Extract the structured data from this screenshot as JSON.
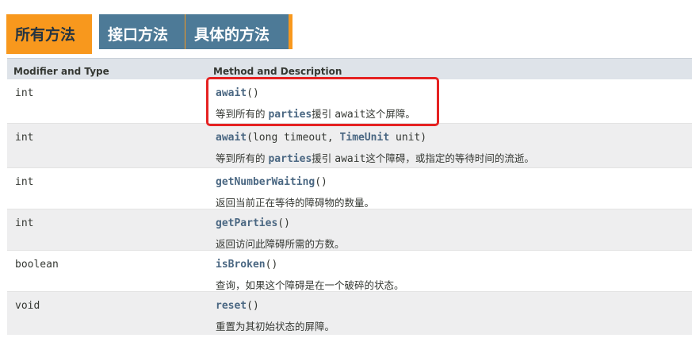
{
  "tabs": {
    "all": "所有方法",
    "interface": "接口方法",
    "concrete": "具体的方法"
  },
  "table": {
    "header_type": "Modifier and Type",
    "header_method": "Method and Description",
    "rows": [
      {
        "type": "int",
        "name": "await",
        "params_open": "(",
        "params_close": ")",
        "desc_pre": "等到所有的 ",
        "desc_code": "parties",
        "desc_mid": "援引 ",
        "desc_code2": "await",
        "desc_post": "这个屏障。"
      },
      {
        "type": "int",
        "name": "await",
        "params_open": "(long timeout, ",
        "tref": "TimeUnit",
        "params_close": " unit)",
        "desc_pre": "等到所有的 ",
        "desc_code": "parties",
        "desc_mid": "援引 ",
        "desc_code2": "await",
        "desc_post": "这个障碍，或指定的等待时间的流逝。"
      },
      {
        "type": "int",
        "name": "getNumberWaiting",
        "params": "()",
        "desc": "返回当前正在等待的障碍物的数量。"
      },
      {
        "type": "int",
        "name": "getParties",
        "params": "()",
        "desc": "返回访问此障碍所需的方数。"
      },
      {
        "type": "boolean",
        "name": "isBroken",
        "params": "()",
        "desc": "查询，如果这个障碍是在一个破碎的状态。"
      },
      {
        "type": "void",
        "name": "reset",
        "params": "()",
        "desc": "重置为其初始状态的屏障。"
      }
    ]
  },
  "colors": {
    "tab_active": "#f8981d",
    "tab_inactive": "#4d7a97",
    "link": "#4a6782",
    "highlight": "#e52222"
  }
}
